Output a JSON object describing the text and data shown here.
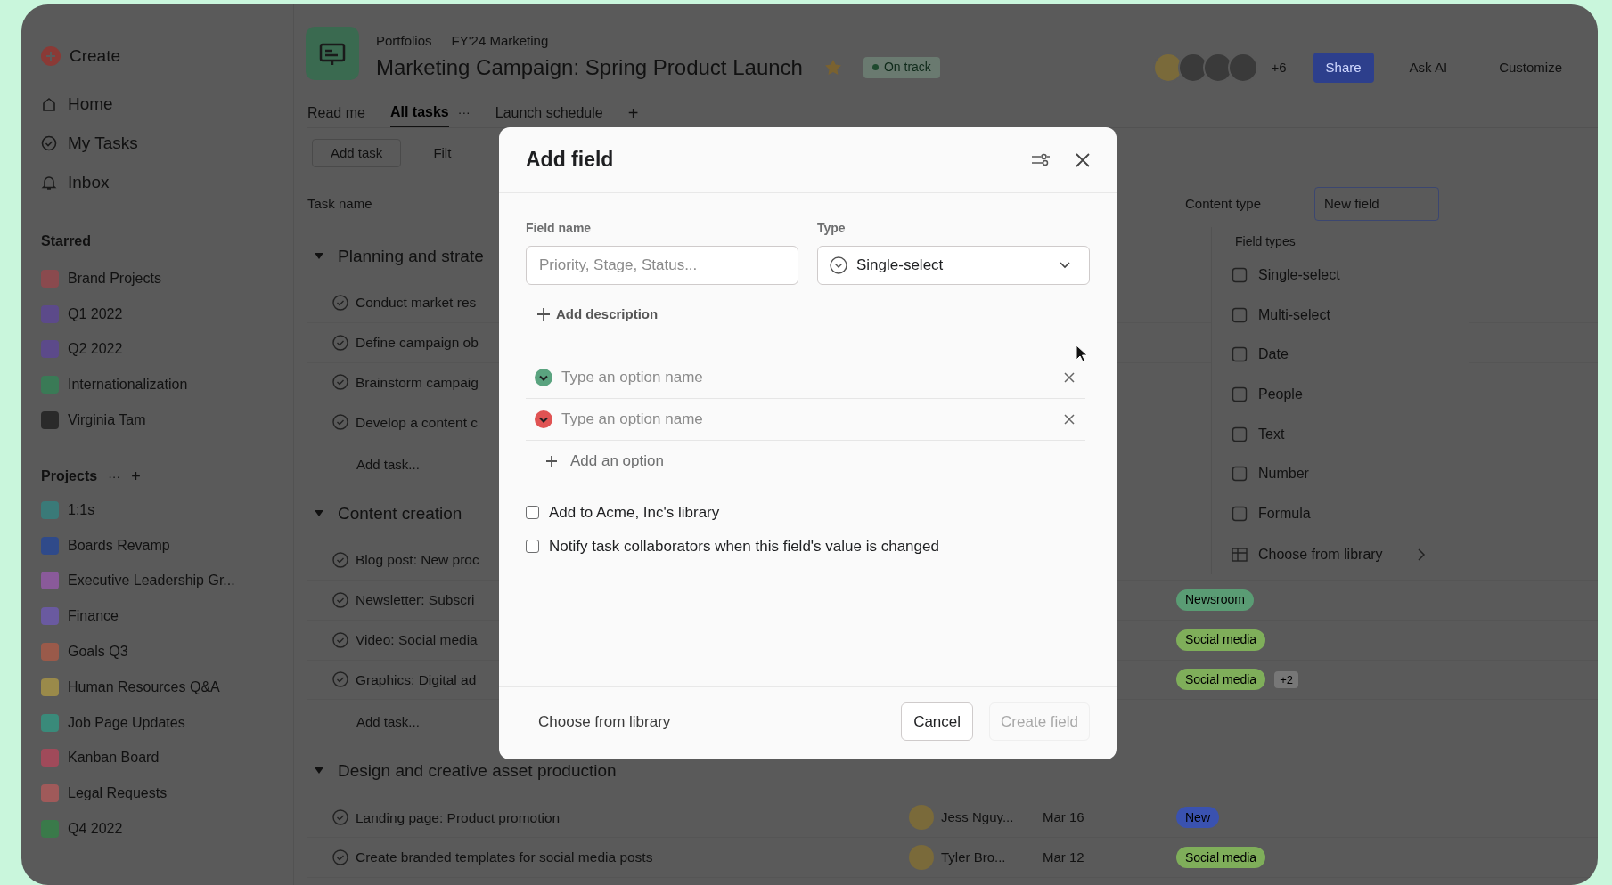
{
  "sidebar": {
    "create": "Create",
    "nav": [
      "Home",
      "My Tasks",
      "Inbox"
    ],
    "starred_heading": "Starred",
    "starred": [
      "Brand Projects",
      "Q1 2022",
      "Q2 2022",
      "Internationalization",
      "Virginia Tam"
    ],
    "projects_heading": "Projects",
    "projects_more": "···",
    "projects_add": "+",
    "projects": [
      "1:1s",
      "Boards Revamp",
      "Executive Leadership Gr...",
      "Finance",
      "Goals Q3",
      "Human Resources Q&A",
      "Job Page Updates",
      "Kanban Board",
      "Legal Requests",
      "Q4 2022"
    ]
  },
  "header": {
    "breadcrumbs": [
      "Portfolios",
      "FY'24 Marketing"
    ],
    "title": "Marketing Campaign: Spring Product Launch",
    "status": "On track",
    "member_count": "+6",
    "share": "Share",
    "ask_ai": "Ask AI",
    "customize": "Customize"
  },
  "tabs": [
    {
      "label": "Read me",
      "selected": false
    },
    {
      "label": "All tasks",
      "selected": true
    },
    {
      "label": "Launch schedule",
      "selected": false
    }
  ],
  "tab_more": "···",
  "tab_add": "+",
  "toolbar": {
    "add_task": "Add task",
    "filter": "Filt"
  },
  "table": {
    "column_1": "Task name",
    "column_2": "Content type",
    "new_field": "New field",
    "sections": [
      {
        "title": "Planning and strate",
        "tasks": [
          {
            "name": "Conduct market res"
          },
          {
            "name": "Define campaign ob"
          },
          {
            "name": "Brainstorm campaig"
          },
          {
            "name": "Develop a content c"
          }
        ],
        "add": "Add task..."
      },
      {
        "title": "Content creation",
        "tasks": [
          {
            "name": "Blog post: New proc"
          },
          {
            "name": "Newsletter: Subscri",
            "tags": [
              {
                "label": "Newsroom",
                "color": "#5a9c74"
              }
            ]
          },
          {
            "name": "Video: Social media",
            "tags": [
              {
                "label": "Social media",
                "color": "#7fae5a"
              }
            ]
          },
          {
            "name": "Graphics: Digital ad",
            "tags": [
              {
                "label": "Social media",
                "color": "#7fae5a"
              }
            ],
            "more": "+2"
          }
        ],
        "add": "Add task..."
      },
      {
        "title": "Design and creative asset production",
        "tasks": [
          {
            "name": "Landing page: Product promotion",
            "assignee": "Jess Nguy...",
            "due": "Mar 16",
            "tags": [
              {
                "label": "New",
                "color": "#3a52b0"
              }
            ]
          },
          {
            "name": "Create branded templates for social media posts",
            "assignee": "Tyler Bro...",
            "due": "Mar 12",
            "tags": [
              {
                "label": "Social media",
                "color": "#7fae5a"
              }
            ]
          }
        ]
      }
    ]
  },
  "field_types_menu": {
    "heading": "Field types",
    "items": [
      "Single-select",
      "Multi-select",
      "Date",
      "People",
      "Text",
      "Number",
      "Formula"
    ],
    "library": "Choose from library"
  },
  "dialog": {
    "title": "Add field",
    "field_name_label": "Field name",
    "field_name_placeholder": "Priority, Stage, Status...",
    "type_label": "Type",
    "type_value": "Single-select",
    "add_description": "Add description",
    "options": [
      {
        "placeholder": "Type an option name",
        "color": "#5aa37f"
      },
      {
        "placeholder": "Type an option name",
        "color": "#e05353"
      }
    ],
    "add_option": "Add an option",
    "checkboxes": [
      {
        "label": "Add to Acme, Inc's library",
        "checked": false
      },
      {
        "label": "Notify task collaborators when this field's value is changed",
        "checked": false
      }
    ],
    "choose_library": "Choose from library",
    "cancel": "Cancel",
    "create": {
      "label": "Create field",
      "disabled": true
    }
  }
}
